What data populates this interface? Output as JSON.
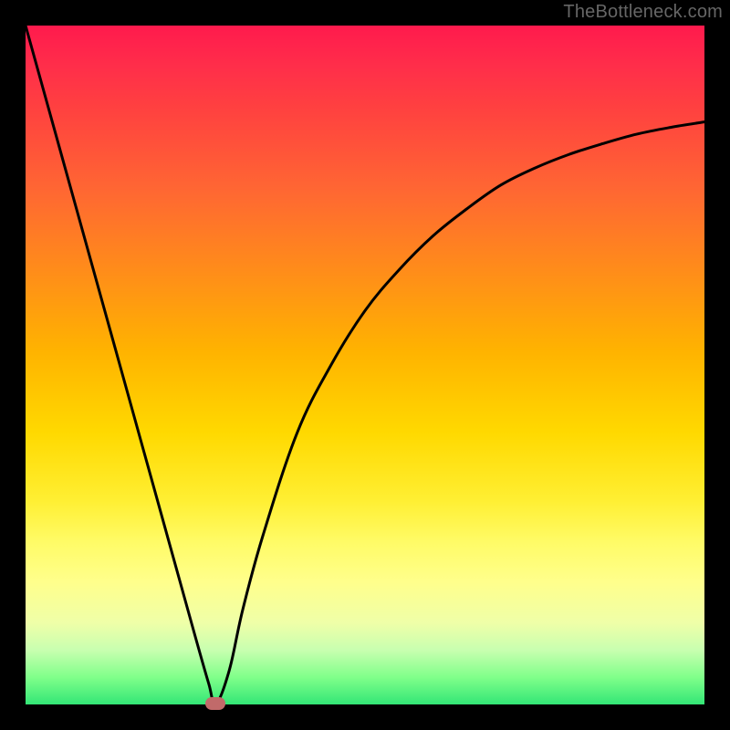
{
  "attribution": "TheBottleneck.com",
  "chart_data": {
    "type": "line",
    "title": "",
    "xlabel": "",
    "ylabel": "",
    "xlim": [
      0,
      100
    ],
    "ylim": [
      0,
      100
    ],
    "series": [
      {
        "name": "curve",
        "x": [
          0,
          5,
          10,
          15,
          20,
          25,
          27,
          28,
          30,
          32,
          35,
          40,
          45,
          50,
          55,
          60,
          65,
          70,
          75,
          80,
          85,
          90,
          95,
          100
        ],
        "values": [
          100,
          82,
          64,
          46,
          28,
          10,
          3,
          0,
          5,
          14,
          25,
          40,
          50,
          58,
          64,
          69,
          73,
          76.5,
          79,
          81,
          82.6,
          84,
          85,
          85.8
        ]
      }
    ],
    "marker": {
      "x": 28,
      "y": 0
    },
    "grid": false,
    "legend": false
  },
  "colors": {
    "background": "#000000",
    "curve": "#000000",
    "marker": "#c16a6a"
  }
}
